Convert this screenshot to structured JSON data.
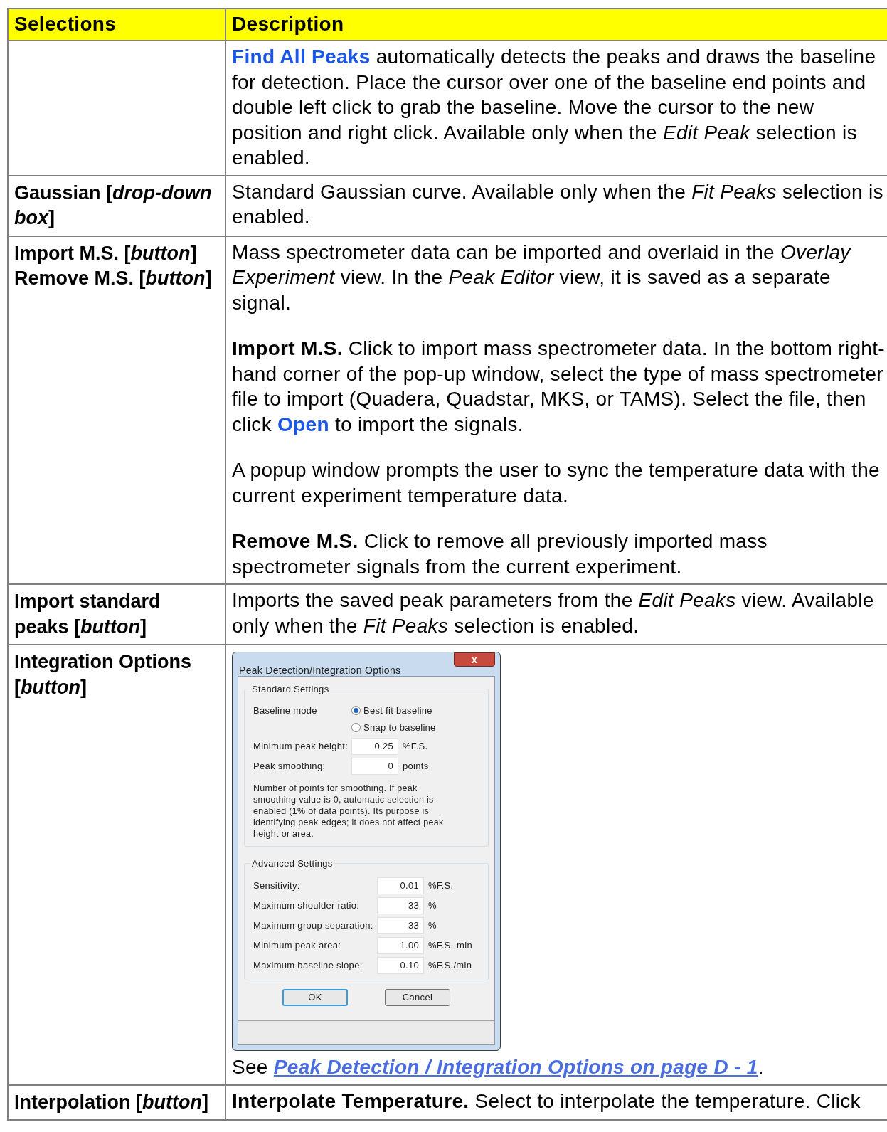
{
  "table": {
    "columns": [
      "Selections",
      "Description"
    ],
    "rows": [
      {
        "selection": [],
        "description": [
          [
            {
              "kind": "link",
              "text": "Find All Peaks"
            },
            {
              "kind": "text",
              "text": " automatically detects the peaks and draws the baseline for detection. Place the cursor over one of the baseline end points and double left click to grab the baseline. Move the cursor to the new position and right click. Available only when the *Edit Peak* selection is enabled."
            }
          ]
        ]
      },
      {
        "selection": [
          "Gaussian [*drop-down box*]"
        ],
        "description": [
          [
            {
              "kind": "text",
              "text": "Standard Gaussian curve. Available only when the *Fit Peaks* selection is enabled."
            }
          ]
        ]
      },
      {
        "selection": [
          "Import M.S. [*button*]",
          "Remove M.S. [*button*]"
        ],
        "description": [
          [
            {
              "kind": "text",
              "text": "Mass spectrometer data can be imported and overlaid in the *Overlay Experiment* view. In the *Peak Editor* view, it is saved as a separate signal."
            }
          ],
          [
            {
              "kind": "text",
              "text": "**Import M.S.** Click to import mass spectrometer data. In the bottom right-hand corner of the pop-up window, select the type of mass spectrometer file to import (Quadera, Quadstar, MKS, or TAMS). Select the file, then click "
            },
            {
              "kind": "link",
              "text": "Open"
            },
            {
              "kind": "text",
              "text": " to import the signals."
            }
          ],
          [
            {
              "kind": "text",
              "text": "A popup window prompts the user to sync the temperature data with the current experiment temperature data."
            }
          ],
          [
            {
              "kind": "text",
              "text": "**Remove M.S.** Click to remove all previously imported mass spectrometer signals from the current experiment."
            }
          ]
        ]
      },
      {
        "selection": [
          "Import standard peaks [*button*]"
        ],
        "description": [
          [
            {
              "kind": "text",
              "text": "Imports the saved peak parameters from the *Edit Peaks* view. Available only when the *Fit Peaks* selection is enabled."
            }
          ]
        ]
      },
      {
        "selection": [
          "Integration Options [*button*]"
        ],
        "dialog": {
          "title": "Peak Detection/Integration Options",
          "close": "x",
          "groups": [
            {
              "title": "Standard Settings",
              "rows": [
                {
                  "kind": "radio",
                  "label": "Baseline mode",
                  "option": "Best fit baseline",
                  "selected": true
                },
                {
                  "kind": "radio",
                  "option": "Snap to baseline",
                  "selected": false
                },
                {
                  "kind": "field",
                  "label": "Minimum peak height:",
                  "value": "0.25",
                  "unit": "%F.S."
                },
                {
                  "kind": "field",
                  "label": "Peak smoothing:",
                  "value": "0",
                  "unit": "points"
                },
                {
                  "kind": "note",
                  "text": "Number of points for smoothing. If peak smoothing value is 0, automatic selection is enabled (1% of data points). Its purpose is identifying peak edges; it does not affect peak height or area."
                }
              ]
            },
            {
              "title": "Advanced Settings",
              "rows": [
                {
                  "kind": "field",
                  "label": "Sensitivity:",
                  "value": "0.01",
                  "unit": "%F.S."
                },
                {
                  "kind": "field",
                  "label": "Maximum shoulder ratio:",
                  "value": "33",
                  "unit": "%"
                },
                {
                  "kind": "field",
                  "label": "Maximum group separation:",
                  "value": "33",
                  "unit": "%"
                },
                {
                  "kind": "field",
                  "label": "Minimum peak area:",
                  "value": "1.00",
                  "unit": "%F.S.·min"
                },
                {
                  "kind": "field",
                  "label": "Maximum baseline slope:",
                  "value": "0.10",
                  "unit": "%F.S./min"
                }
              ]
            }
          ],
          "buttons": [
            {
              "label": "OK",
              "default": true
            },
            {
              "label": "Cancel",
              "default": false
            }
          ]
        },
        "description": [
          [
            {
              "kind": "text",
              "text": "See "
            },
            {
              "kind": "xref",
              "text": "Peak Detection / Integration Options on page D - 1"
            },
            {
              "kind": "text",
              "text": "."
            }
          ]
        ]
      },
      {
        "selection": [
          "Interpolation [*button*]"
        ],
        "description": [
          [
            {
              "kind": "text",
              "text": "**Interpolate Temperature.** Select to interpolate the temperature. Click"
            }
          ]
        ]
      }
    ]
  }
}
